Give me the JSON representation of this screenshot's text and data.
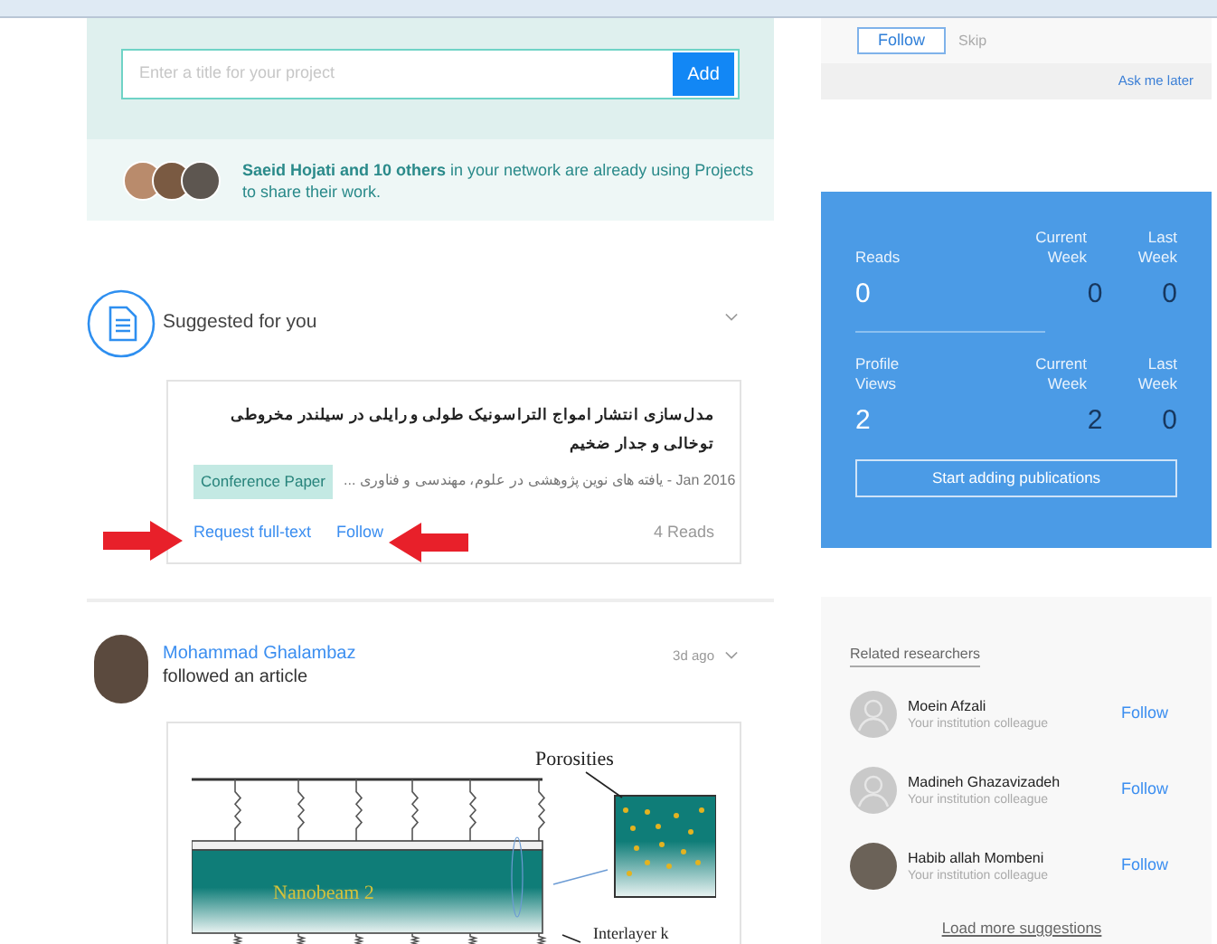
{
  "project_box": {
    "placeholder": "Enter a title for your project",
    "button": "Add",
    "network_text": "**Saeid Hojati and 10 others** in your network are already using Projects to share their work."
  },
  "suggested": {
    "heading": "Suggested for you",
    "title": "مدل‌سازی انتشار امواج التراسونیک طولی و رایلی در سیلندر مخروطی توخالی و جدار ضخیم",
    "type": "Conference Paper",
    "meta": "Jan 2016 - یافته های نوین پژوهشی در علوم، مهندسی و فناوری ...",
    "actions": [
      "Request full-text",
      "Follow"
    ],
    "reads": "4 Reads"
  },
  "activity": {
    "name": "Mohammad Ghalambaz",
    "action": "followed an article",
    "time": "3d ago",
    "figure_labels": [
      "Porosities",
      "Nanobeam 2",
      "Interlayer k"
    ]
  },
  "follow_prompt": {
    "follow": "Follow",
    "skip": "Skip",
    "later": "Ask me later"
  },
  "stats": {
    "rows": [
      {
        "label": "Reads",
        "total": "0",
        "current_header": "Current Week",
        "current": "0",
        "last_header": "Last Week",
        "last": "0"
      },
      {
        "label": "Profile Views",
        "total": "2",
        "current_header": "Current Week",
        "current": "2",
        "last_header": "Last Week",
        "last": "0"
      }
    ],
    "button": "Start adding publications"
  },
  "related": {
    "heading": "Related researchers",
    "people": [
      {
        "name": "Moein Afzali",
        "subtitle": "Your institution colleague",
        "action": "Follow",
        "kind": "default"
      },
      {
        "name": "Madineh Ghazavizadeh",
        "subtitle": "Your institution colleague",
        "action": "Follow",
        "kind": "default"
      },
      {
        "name": "Habib allah Mombeni",
        "subtitle": "Your institution colleague",
        "action": "Follow",
        "kind": "photo"
      }
    ],
    "more": "Load more suggestions"
  }
}
